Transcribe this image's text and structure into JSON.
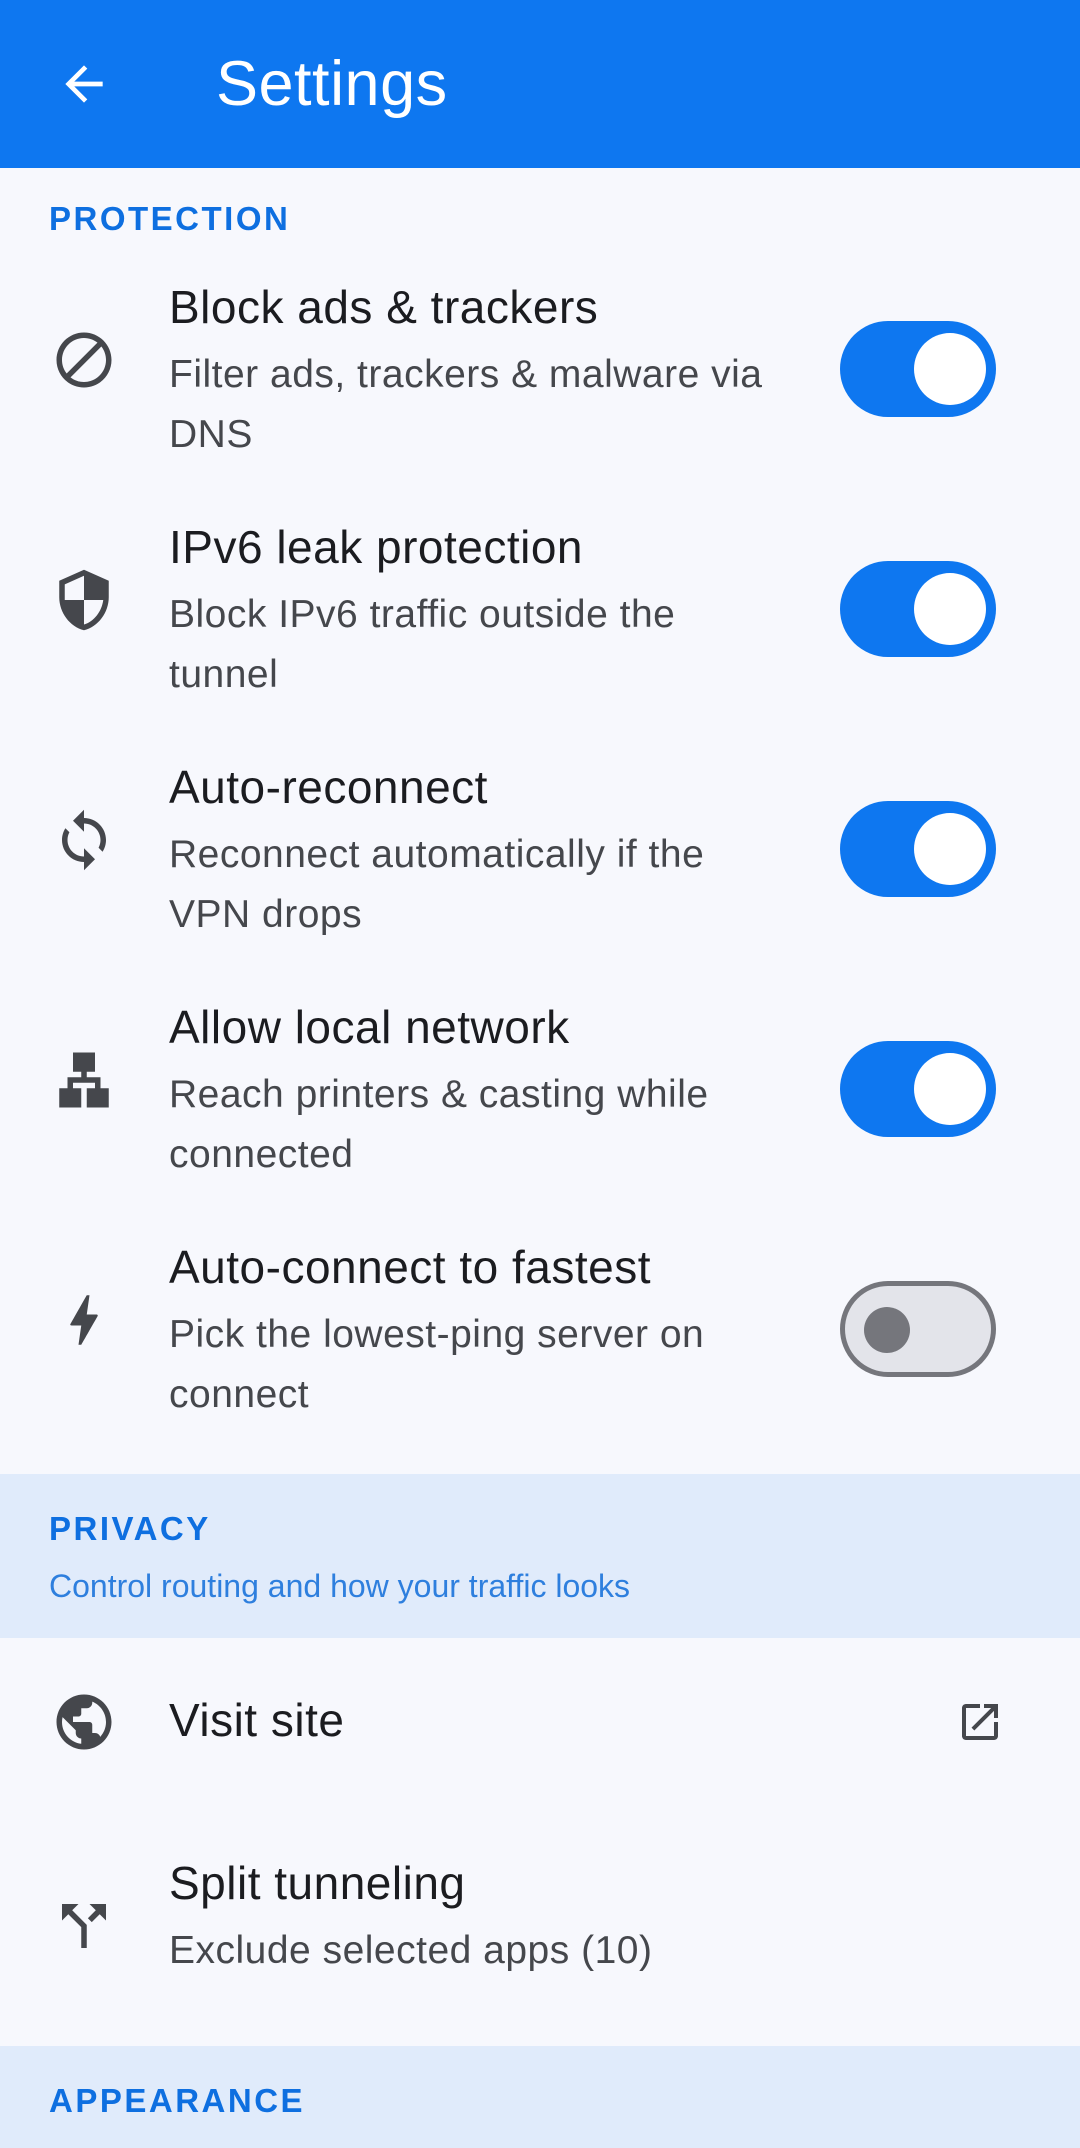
{
  "header": {
    "title": "Settings",
    "back_icon": "arrow-back-icon",
    "background": "#0e77f0"
  },
  "protection": {
    "label": "PROTECTION",
    "items": [
      {
        "title": "Block ads & trackers",
        "description": "Filter ads, trackers & malware via DNS",
        "icon": "block-icon",
        "enabled": true
      },
      {
        "title": "IPv6 leak protection",
        "description": "Block IPv6 traffic outside the tunnel",
        "icon": "shield-icon",
        "enabled": true
      },
      {
        "title": "Auto-reconnect",
        "description": "Reconnect automatically if the VPN drops",
        "icon": "sync-icon",
        "enabled": true
      },
      {
        "title": "Allow local network",
        "description": "Reach printers & casting while connected",
        "icon": "lan-icon",
        "enabled": true
      },
      {
        "title": "Auto-connect to fastest",
        "description": "Pick the lowest-ping server on connect",
        "icon": "bolt-icon",
        "enabled": false
      }
    ]
  },
  "privacy": {
    "label": "PRIVACY",
    "subtitle": "Control routing and how your traffic looks",
    "visit_site": {
      "title": "Visit site",
      "icon": "globe-icon",
      "trailing_icon": "open-in-new-icon"
    },
    "split_tunneling": {
      "title": "Split tunneling",
      "description": "Exclude selected apps (10)",
      "icon": "call-split-icon"
    }
  },
  "appearance": {
    "label": "APPEARANCE"
  },
  "colors": {
    "accent": "#0e77f0",
    "section_label": "#0e6fe0",
    "section_tint": "#e0ebfb",
    "switch_off_outline": "#75767c"
  }
}
